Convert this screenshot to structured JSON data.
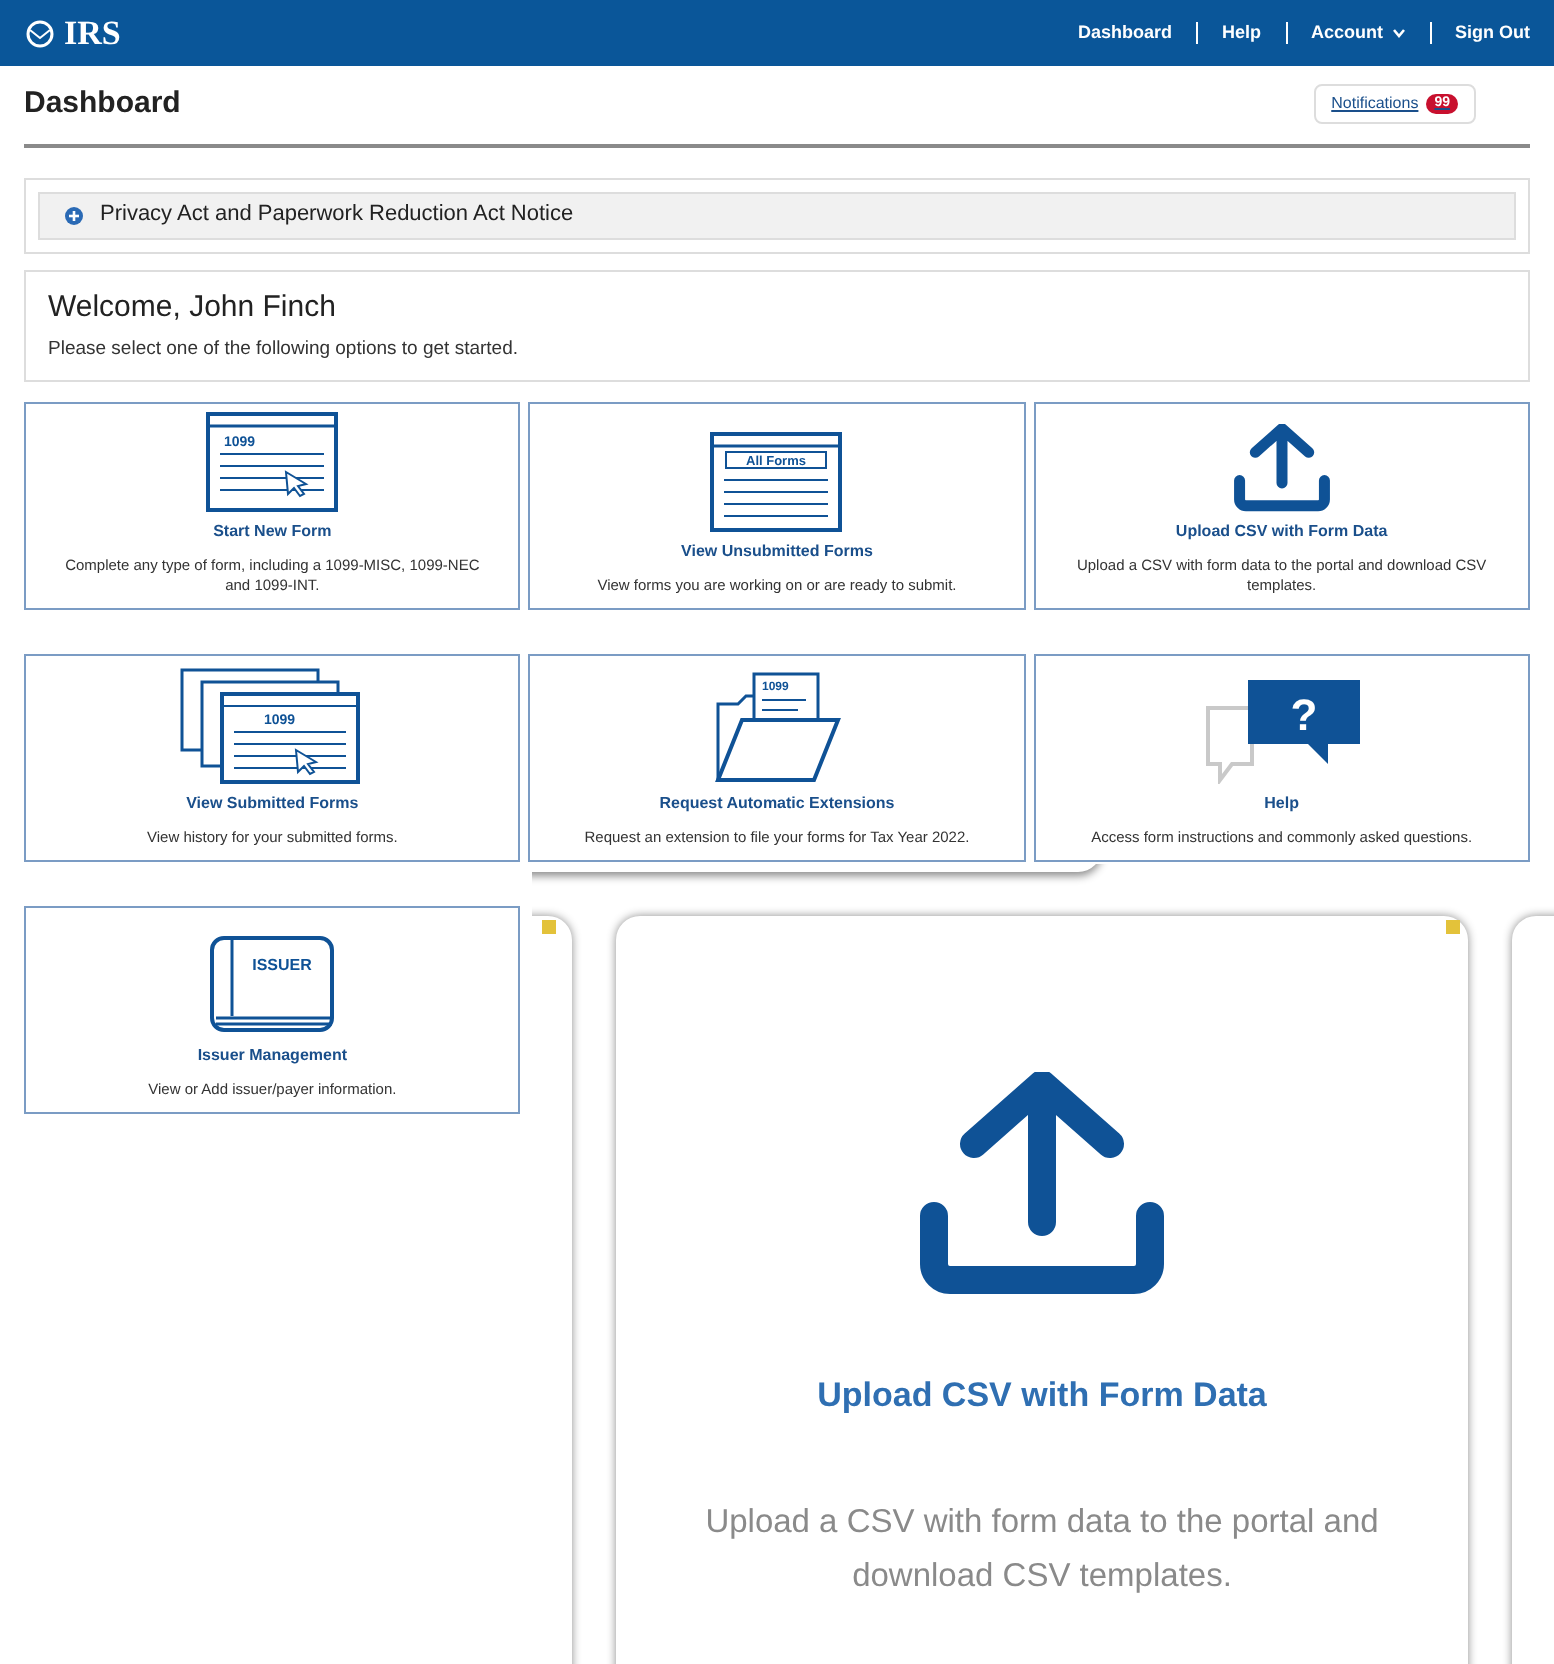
{
  "header": {
    "logo": "IRS",
    "nav": [
      {
        "label": "Dashboard",
        "kind": "link"
      },
      {
        "label": "Help",
        "kind": "link"
      },
      {
        "label": "Account",
        "kind": "menu"
      },
      {
        "label": "Sign Out",
        "kind": "link"
      }
    ]
  },
  "page_title": "Dashboard",
  "notifications": {
    "label": "Notifications",
    "count": "99"
  },
  "privacy_notice": {
    "label": "Privacy Act and Paperwork Reduction Act Notice",
    "expanded": false
  },
  "welcome": {
    "heading": "Welcome, John Finch",
    "subtitle": "Please select one of the following options to get started."
  },
  "cards": [
    {
      "kind": "form",
      "icon_text": "1099",
      "title": "Start New Form",
      "description": "Complete any type of form, including a 1099-MISC, 1099-NEC and 1099-INT."
    },
    {
      "kind": "forms-list",
      "icon_text": "All Forms",
      "title": "View Unsubmitted Forms",
      "description": "View forms you are working on or are ready to submit."
    },
    {
      "kind": "upload",
      "title": "Upload CSV with Form Data",
      "description": "Upload a CSV with form data to the portal and download CSV templates."
    },
    {
      "kind": "stack",
      "icon_text": "1099",
      "title": "View Submitted Forms",
      "description": "View history for your submitted forms."
    },
    {
      "kind": "folder",
      "icon_text": "1099",
      "title": "Request Automatic Extensions",
      "description": "Request an extension to file your forms for Tax Year 2022."
    },
    {
      "kind": "help",
      "icon_text": "?",
      "title": "Help",
      "description": "Access form instructions and commonly asked questions."
    },
    {
      "kind": "book",
      "icon_text": "ISSUER",
      "title": "Issuer Management",
      "description": "View or Add issuer/payer information."
    }
  ],
  "inset": {
    "title": "Upload CSV with Form Data",
    "description": "Upload a CSV with form data to the portal and download CSV templates."
  }
}
